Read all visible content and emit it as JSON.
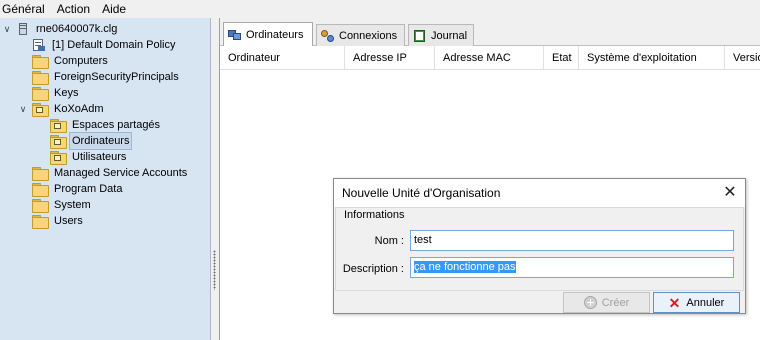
{
  "menubar": {
    "items": [
      "Général",
      "Action",
      "Aide"
    ]
  },
  "tree": {
    "root": "rne0640007k.clg",
    "items": [
      "[1] Default Domain Policy",
      "Computers",
      "ForeignSecurityPrincipals",
      "Keys",
      "KoXoAdm",
      "Espaces partagés",
      "Ordinateurs",
      "Utilisateurs",
      "Managed Service Accounts",
      "Program Data",
      "System",
      "Users"
    ]
  },
  "tabs": [
    "Ordinateurs",
    "Connexions",
    "Journal"
  ],
  "columns": [
    "Ordinateur",
    "Adresse IP",
    "Adresse MAC",
    "Etat",
    "Système d'exploitation",
    "Version"
  ],
  "dialog": {
    "title": "Nouvelle Unité d'Organisation",
    "close": "✕",
    "group_label": "Informations",
    "name_label": "Nom :",
    "name_value": "test",
    "description_label": "Description :",
    "description_value": "ça ne fonctionne pas",
    "create_button": "Créer",
    "cancel_button": "Annuler"
  }
}
